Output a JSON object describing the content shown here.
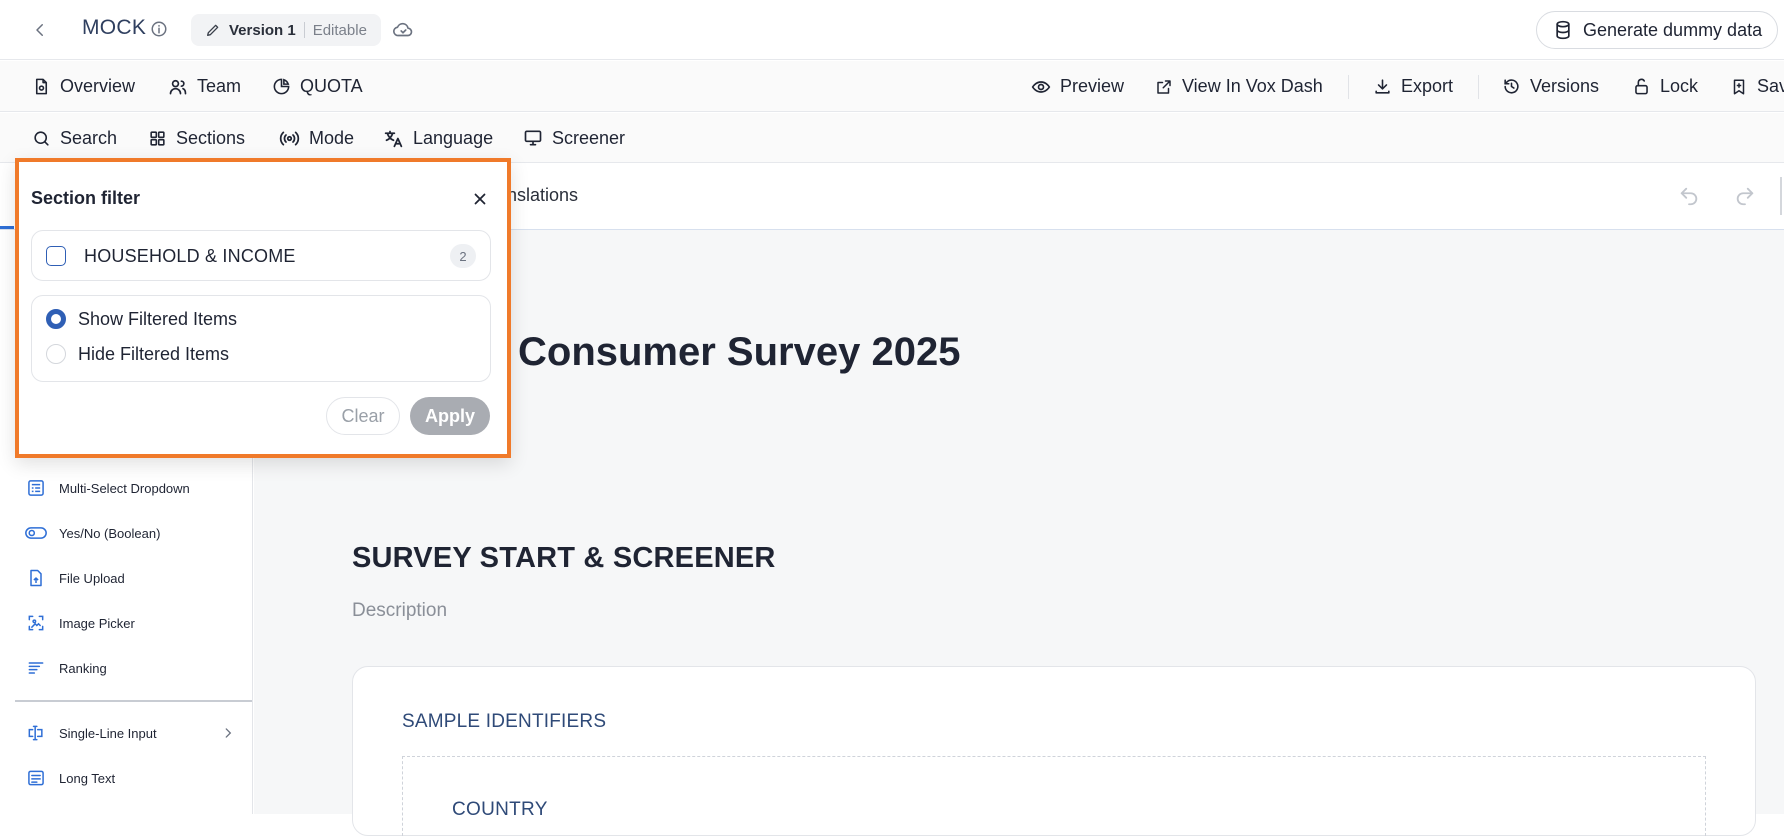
{
  "topbar": {
    "project_title": "MOCK",
    "version_name": "Version 1",
    "version_state": "Editable",
    "generate_label": "Generate dummy data"
  },
  "nav": {
    "overview": "Overview",
    "team": "Team",
    "quota": "QUOTA",
    "preview": "Preview",
    "view_in_vox": "View In Vox Dash",
    "export": "Export",
    "versions": "Versions",
    "lock": "Lock",
    "save": "Sav"
  },
  "toolbar": {
    "search": "Search",
    "sections": "Sections",
    "mode": "Mode",
    "language": "Language",
    "screener": "Screener"
  },
  "tabs": {
    "partial_label": "anslations"
  },
  "sidebar": {
    "items": [
      {
        "label": "Multi-Select Dropdown",
        "icon": "multi-select-dropdown-icon"
      },
      {
        "label": "Yes/No (Boolean)",
        "icon": "toggle-icon"
      },
      {
        "label": "File Upload",
        "icon": "file-upload-icon"
      },
      {
        "label": "Image Picker",
        "icon": "image-picker-icon"
      },
      {
        "label": "Ranking",
        "icon": "ranking-icon"
      },
      {
        "label": "Single-Line Input",
        "icon": "text-cursor-icon"
      },
      {
        "label": "Long Text",
        "icon": "long-text-icon"
      }
    ]
  },
  "main": {
    "survey_title": "Consumer Survey 2025",
    "section_title": "SURVEY START & SCREENER",
    "section_description": "Description",
    "card_title": "SAMPLE IDENTIFIERS",
    "field_label": "COUNTRY"
  },
  "popover": {
    "title": "Section filter",
    "filter_item": {
      "label": "HOUSEHOLD & INCOME",
      "count": "2",
      "checked": false
    },
    "radio_show": "Show Filtered Items",
    "radio_hide": "Hide Filtered Items",
    "selected_mode": "show",
    "clear_label": "Clear",
    "apply_label": "Apply"
  },
  "colors": {
    "accent": "#2f6fd6",
    "highlight_border": "#f07a2a",
    "apply_disabled": "#a9acb2"
  }
}
